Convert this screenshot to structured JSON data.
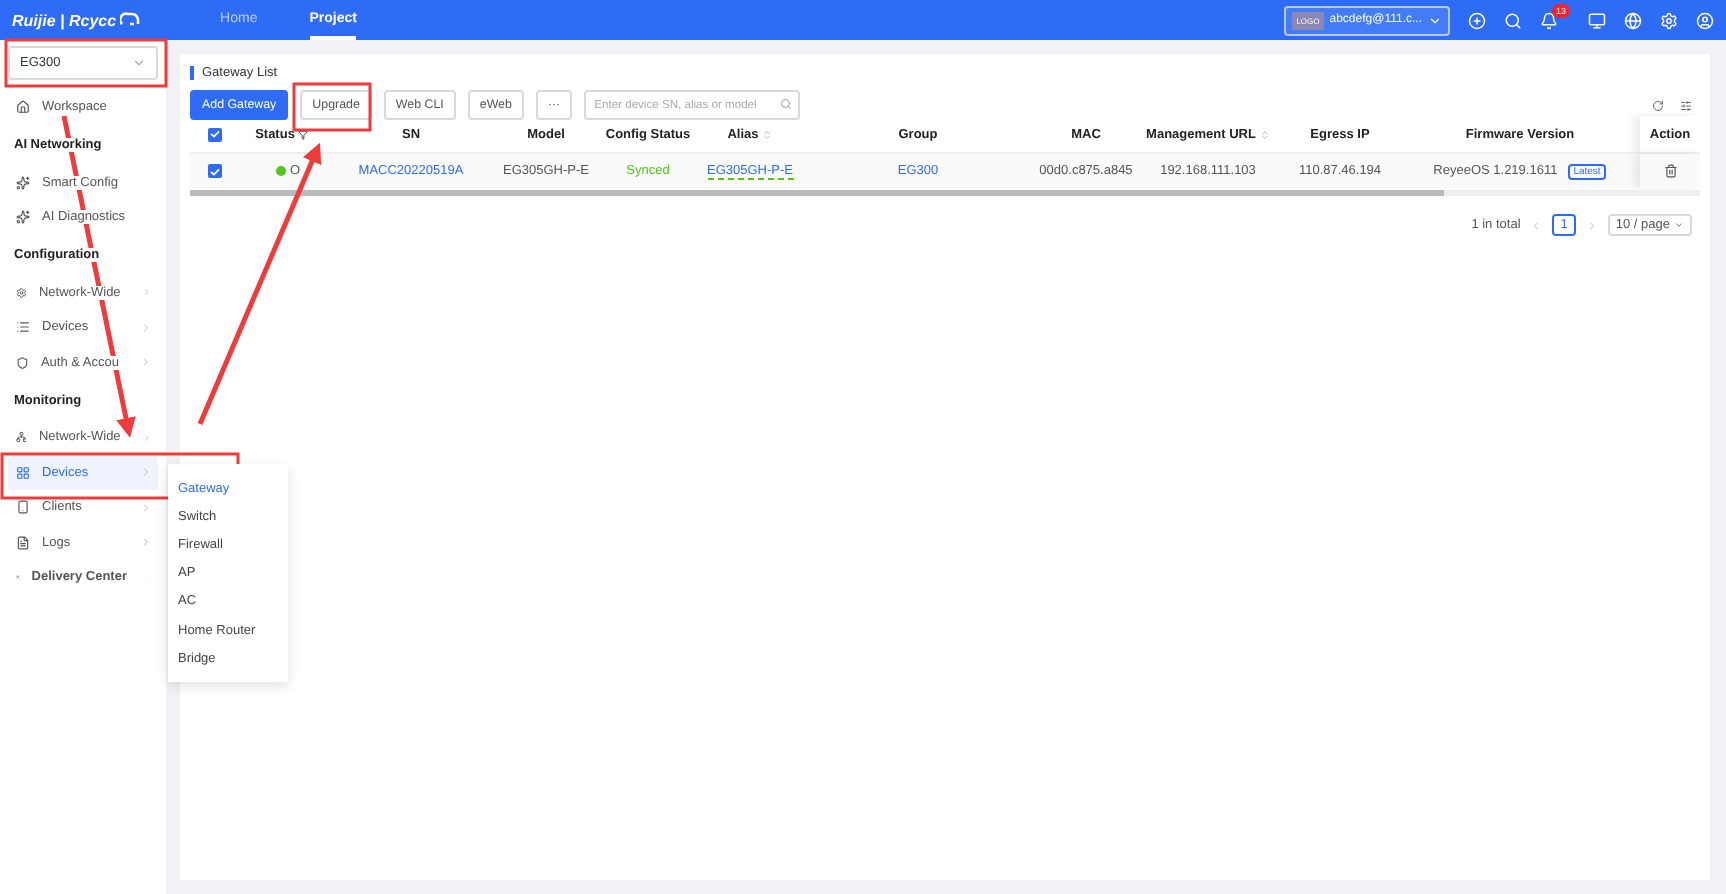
{
  "topbar": {
    "logo": "Ruijie | Rcycc",
    "nav": [
      {
        "label": "Home",
        "selected": false
      },
      {
        "label": "Project",
        "selected": true
      }
    ],
    "account": {
      "logo": "LOGO",
      "name": "abcdefg@111.c..."
    },
    "notification_count": "13"
  },
  "sidebar": {
    "project_select": "EG300",
    "items": [
      {
        "kind": "item",
        "label": "Workspace",
        "selected": false,
        "arrow": false
      },
      {
        "kind": "header",
        "label": "AI Networking"
      },
      {
        "kind": "item",
        "label": "Smart Config",
        "selected": false,
        "arrow": false
      },
      {
        "kind": "item",
        "label": "AI Diagnostics",
        "selected": false,
        "arrow": false
      },
      {
        "kind": "header",
        "label": "Configuration"
      },
      {
        "kind": "item",
        "label": "Network-Wide",
        "selected": false,
        "arrow": true
      },
      {
        "kind": "item",
        "label": "Devices",
        "selected": false,
        "arrow": true
      },
      {
        "kind": "item",
        "label": "Auth & Accou",
        "selected": false,
        "arrow": true
      },
      {
        "kind": "header",
        "label": "Monitoring"
      },
      {
        "kind": "item",
        "label": "Network-Wide",
        "selected": false,
        "arrow": true
      },
      {
        "kind": "item",
        "label": "Devices",
        "selected": true,
        "arrow": true
      },
      {
        "kind": "item",
        "label": "Clients",
        "selected": false,
        "arrow": true
      },
      {
        "kind": "item",
        "label": "Logs",
        "selected": false,
        "arrow": true
      },
      {
        "kind": "bold",
        "label": "Delivery Center",
        "selected": false,
        "arrow": true
      }
    ]
  },
  "submenu": [
    {
      "label": "Gateway",
      "selected": true
    },
    {
      "label": "Switch",
      "selected": false
    },
    {
      "label": "Firewall",
      "selected": false
    },
    {
      "label": "AP",
      "selected": false
    },
    {
      "label": "AC",
      "selected": false
    },
    {
      "label": "Home Router",
      "selected": false
    },
    {
      "label": "Bridge",
      "selected": false
    }
  ],
  "panel": {
    "title": "Gateway List",
    "buttons": [
      {
        "label": "Add Gateway",
        "kind": "primary"
      },
      {
        "label": "Upgrade",
        "kind": "default"
      },
      {
        "label": "Web CLI",
        "kind": "default"
      },
      {
        "label": "eWeb",
        "kind": "default"
      },
      {
        "label": "···",
        "kind": "default"
      }
    ],
    "search": {
      "placeholder": "Enter device SN, alias or model"
    }
  },
  "table": {
    "all_checked": true,
    "columns": [
      {
        "label": "Status",
        "kind": "filter"
      },
      {
        "label": "SN",
        "kind": "plain"
      },
      {
        "label": "Model",
        "kind": "plain"
      },
      {
        "label": "Config Status",
        "kind": "plain"
      },
      {
        "label": "Alias",
        "kind": "sort"
      },
      {
        "label": "Group",
        "kind": "plain"
      },
      {
        "label": "MAC",
        "kind": "plain"
      },
      {
        "label": "Management URL",
        "kind": "sort"
      },
      {
        "label": "Egress IP",
        "kind": "plain"
      },
      {
        "label": "Firmware Version",
        "kind": "plain"
      },
      {
        "label": "Action",
        "kind": "plain"
      }
    ],
    "rows": [
      {
        "checked": true,
        "status": "O",
        "sn": "MACC20220519A",
        "model": "EG305GH-P-E",
        "config_status": "Synced",
        "alias": "EG305GH-P-E",
        "group": "EG300",
        "mac": "00d0.c875.a845",
        "management_url": "192.168.111.103",
        "egress_ip": "110.87.46.194",
        "firmware": "ReyeeOS 1.219.1611",
        "firmware_badge": "Latest"
      }
    ]
  },
  "pagination": {
    "total": "1 in total",
    "pages": [
      {
        "label": "1",
        "selected": true
      }
    ],
    "page_size": "10 / page"
  }
}
